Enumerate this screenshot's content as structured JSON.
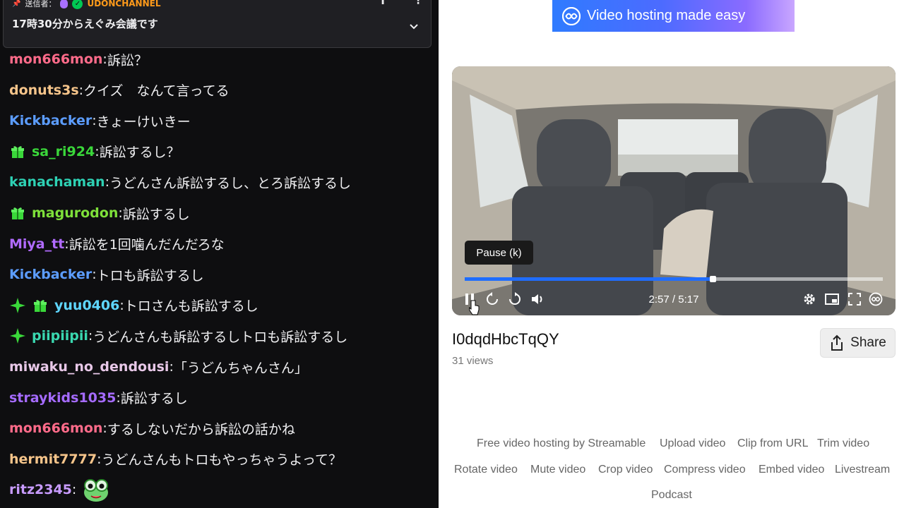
{
  "chat": {
    "pinned": {
      "sender_label": "送信者：",
      "channel": "UDONCHANNEL",
      "message": "17時30分からえぐみ会議です"
    },
    "messages": [
      {
        "user": "mon666mon",
        "color": "#ff6b8a",
        "text": "訴訟？"
      },
      {
        "user": "donuts3s",
        "color": "#f5c48a",
        "text": "クイズ　なんて言ってる"
      },
      {
        "user": "Kickbacker",
        "color": "#5c9dff",
        "text": "きょーけいきー"
      },
      {
        "user": "sa_ri924",
        "color": "#3ad83a",
        "text": "訴訟するし？",
        "badges": [
          "gift-icon"
        ]
      },
      {
        "user": "kanachaman",
        "color": "#2ed1b4",
        "text": "うどんさん訴訟するし、とろ訴訟するし"
      },
      {
        "user": "magurodon",
        "color": "#7ee03a",
        "text": "訴訟するし",
        "badges": [
          "gift-icon"
        ]
      },
      {
        "user": "Miya_tt",
        "color": "#b16bff",
        "text": "訴訟を1回噛んだんだろな"
      },
      {
        "user": "Kickbacker",
        "color": "#5c9dff",
        "text": "トロも訴訟するし"
      },
      {
        "user": "yuu0406",
        "color": "#5fd6ff",
        "text": "トロさんも訴訟するし",
        "badges": [
          "sparkle-icon",
          "gift-icon"
        ]
      },
      {
        "user": "piipiipii",
        "color": "#3ad8b0",
        "text": "うどんさんも訴訟するしトロも訴訟するし",
        "badges": [
          "sparkle-icon"
        ]
      },
      {
        "user": "miwaku_no_dendousi",
        "color": "#e8c8e8",
        "text": "「うどんちゃんさん」"
      },
      {
        "user": "straykids1035",
        "color": "#a56bff",
        "text": "訴訟するし"
      },
      {
        "user": "mon666mon",
        "color": "#ff6b8a",
        "text": "するしないだから訴訟の話かね"
      },
      {
        "user": "hermit7777",
        "color": "#f5c48a",
        "text": "うどんさんもトロもやっちゃうよって？"
      },
      {
        "user": "ritz2345",
        "color": "#c89bff",
        "text": "",
        "emote": "frog-emote"
      }
    ]
  },
  "banner": {
    "text": "Video hosting made easy",
    "icon": "streamable-logo-icon"
  },
  "player": {
    "tooltip": "Pause (k)",
    "current_time": "2:57",
    "duration": "5:17",
    "time_display": "2:57 / 5:17",
    "progress_fraction": 0.593,
    "accent": "#1f6dff"
  },
  "video": {
    "title": "I0dqdHbcTqQY",
    "views": "31 views",
    "share_label": "Share"
  },
  "footer": {
    "links": [
      "Free video hosting by Streamable",
      "Upload video",
      "Clip from URL",
      "Trim video",
      "Rotate video",
      "Mute video",
      "Crop video",
      "Compress video",
      "Embed video",
      "Livestream",
      "Podcast"
    ]
  }
}
